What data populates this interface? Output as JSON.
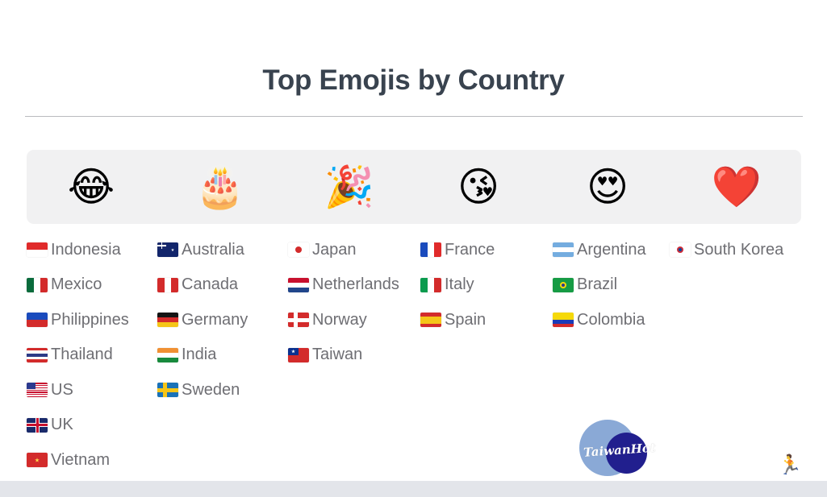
{
  "header": {
    "title": "Top Emojis by Country"
  },
  "emoji_band": {
    "emojis": [
      {
        "glyph": "😂",
        "name": "face-with-tears-of-joy"
      },
      {
        "glyph": "🎂",
        "name": "birthday-cake"
      },
      {
        "glyph": "🎉",
        "name": "party-popper"
      },
      {
        "glyph": "😘",
        "name": "face-blowing-a-kiss"
      },
      {
        "glyph": "😍",
        "name": "smiling-face-with-heart-eyes"
      },
      {
        "glyph": "❤️",
        "name": "red-heart"
      }
    ]
  },
  "columns": [
    {
      "emoji_name": "face-with-tears-of-joy",
      "countries": [
        {
          "name": "Indonesia",
          "flag": "🇮🇩"
        },
        {
          "name": "Mexico",
          "flag": "🇲🇽"
        },
        {
          "name": "Philippines",
          "flag": "🇵🇭"
        },
        {
          "name": "Thailand",
          "flag": "🇹🇭"
        },
        {
          "name": "US",
          "flag": "🇺🇸"
        },
        {
          "name": "UK",
          "flag": "🇬🇧"
        },
        {
          "name": "Vietnam",
          "flag": "🇻🇳"
        }
      ]
    },
    {
      "emoji_name": "birthday-cake",
      "countries": [
        {
          "name": "Australia",
          "flag": "🇦🇺"
        },
        {
          "name": "Canada",
          "flag": "🇨🇦"
        },
        {
          "name": "Germany",
          "flag": "🇩🇪"
        },
        {
          "name": "India",
          "flag": "🇮🇳"
        },
        {
          "name": "Sweden",
          "flag": "🇸🇪"
        }
      ]
    },
    {
      "emoji_name": "party-popper",
      "countries": [
        {
          "name": "Japan",
          "flag": "🇯🇵"
        },
        {
          "name": "Netherlands",
          "flag": "🇳🇱"
        },
        {
          "name": "Norway",
          "flag": "🇳🇴"
        },
        {
          "name": "Taiwan",
          "flag": "🇹🇼"
        }
      ]
    },
    {
      "emoji_name": "face-blowing-a-kiss",
      "countries": [
        {
          "name": "France",
          "flag": "🇫🇷"
        },
        {
          "name": "Italy",
          "flag": "🇮🇹"
        },
        {
          "name": "Spain",
          "flag": "🇪🇸"
        }
      ]
    },
    {
      "emoji_name": "smiling-face-with-heart-eyes",
      "countries": [
        {
          "name": "Argentina",
          "flag": "🇦🇷"
        },
        {
          "name": "Brazil",
          "flag": "🇧🇷"
        },
        {
          "name": "Colombia",
          "flag": "🇨🇴"
        }
      ]
    },
    {
      "emoji_name": "red-heart",
      "countries": [
        {
          "name": "South Korea",
          "flag": "🇰🇷"
        }
      ]
    }
  ],
  "watermark": {
    "text": "TaiwanHot"
  },
  "corner_icon": {
    "glyph": "🏃",
    "name": "running-person-icon"
  },
  "colors": {
    "title": "#39434f",
    "label": "#6e6e73",
    "band_background": "#f1f1f2",
    "divider": "#b9bbbe",
    "watermark_light": "#8aa9d6",
    "watermark_dark": "#211f8e",
    "bottom_strip": "#e3e5ea"
  }
}
